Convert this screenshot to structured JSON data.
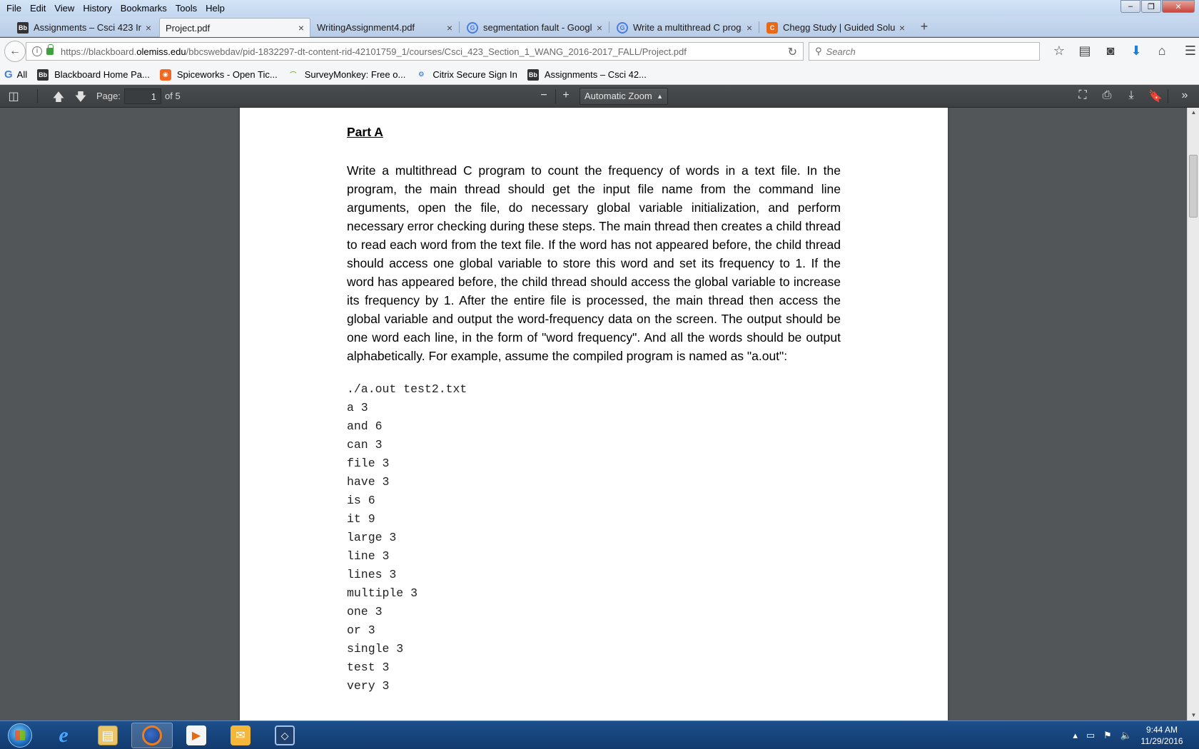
{
  "menu": [
    "File",
    "Edit",
    "View",
    "History",
    "Bookmarks",
    "Tools",
    "Help"
  ],
  "window_controls": {
    "minimize": "–",
    "restore": "❐",
    "close": "✕"
  },
  "tabs": [
    {
      "label": "Assignments – Csci 423 Int...",
      "icon": "blackboard-icon"
    },
    {
      "label": "Project.pdf",
      "icon": "none",
      "active": true
    },
    {
      "label": "WritingAssignment4.pdf",
      "icon": "none"
    },
    {
      "label": "segmentation fault - Googl...",
      "icon": "google-icon"
    },
    {
      "label": "Write a multithread C prog...",
      "icon": "google-icon"
    },
    {
      "label": "Chegg Study | Guided Solu...",
      "icon": "chegg-icon"
    }
  ],
  "urlbar": {
    "prefix": "https://blackboard.",
    "host": "olemiss.edu",
    "path": "/bbcswebdav/pid-1832297-dt-content-rid-42101759_1/courses/Csci_423_Section_1_WANG_2016-2017_FALL/Project.pdf"
  },
  "search": {
    "placeholder": "Search"
  },
  "bookmarks": [
    {
      "label": "All",
      "icon": "google-icon"
    },
    {
      "label": "Blackboard Home Pa...",
      "icon": "blackboard-icon"
    },
    {
      "label": "Spiceworks - Open Tic...",
      "icon": "spiceworks-icon"
    },
    {
      "label": "SurveyMonkey: Free o...",
      "icon": "surveymonkey-icon"
    },
    {
      "label": "Citrix Secure Sign In",
      "icon": "citrix-icon"
    },
    {
      "label": "Assignments – Csci 42...",
      "icon": "blackboard-icon"
    }
  ],
  "pdf_toolbar": {
    "page_label": "Page:",
    "page_value": "1",
    "page_of": "of 5",
    "zoom": "Automatic Zoom"
  },
  "document": {
    "heading": "Part A",
    "paragraph": "Write a multithread C program to count the frequency of words in a text file. In the program, the main thread should get the input file name from the command line arguments, open the file, do necessary global variable initialization, and perform necessary error checking during these steps. The main thread then creates a child thread to read each word from the text file. If the word has not appeared before, the child thread should access one global variable to store this word and set its frequency to 1. If the word has appeared before, the child thread should access the global variable to increase its frequency by 1. After the entire file is processed, the main thread then access the global variable and output the word-frequency data on the screen. The output should be one word each line, in the form of \"word frequency\". And all the words should be output alphabetically. For example, assume the compiled program is named as \"a.out\":",
    "code_lines": [
      "./a.out test2.txt",
      "a 3",
      "and 6",
      "can 3",
      "file 3",
      "have 3",
      "is 6",
      "it 9",
      "large 3",
      "line 3",
      "lines 3",
      "multiple 3",
      "one 3",
      "or 3",
      "single 3",
      "test 3",
      "very 3"
    ]
  },
  "taskbar": {
    "apps": [
      "internet-explorer-icon",
      "file-explorer-icon",
      "firefox-icon",
      "media-player-icon",
      "outlook-icon",
      "virtualbox-icon"
    ],
    "clock_time": "9:44 AM",
    "clock_date": "11/29/2016"
  }
}
